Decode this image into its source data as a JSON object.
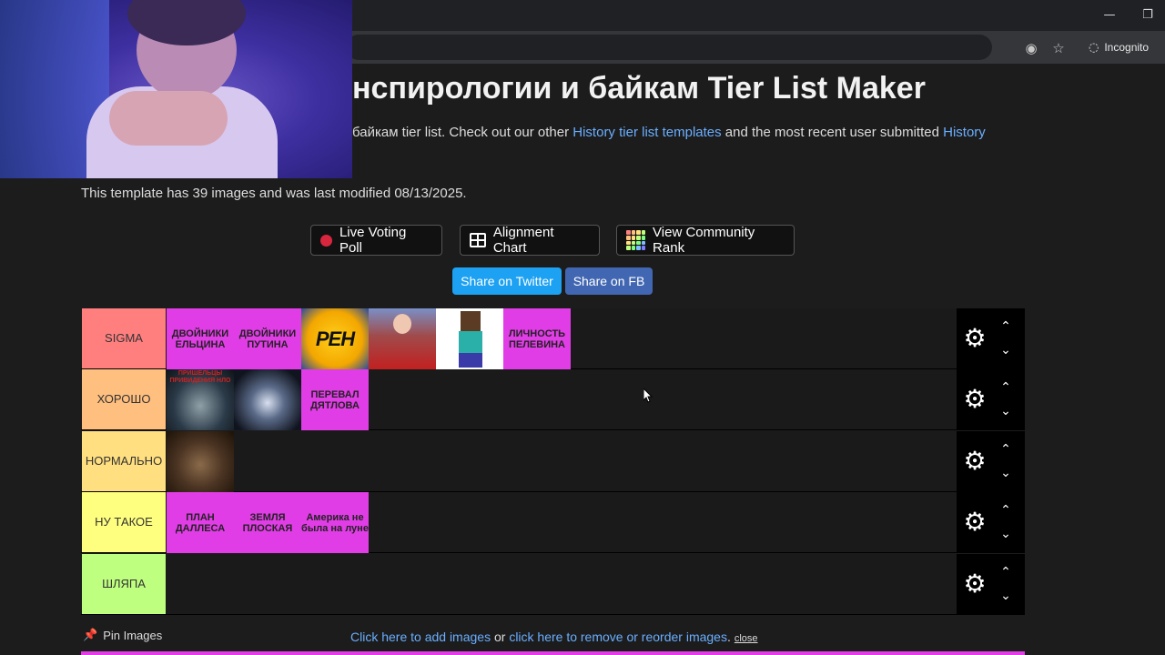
{
  "browser": {
    "incognito_label": "Incognito",
    "minimize_icon": "minimize-icon",
    "restore_icon": "restore-icon",
    "eye_off_icon": "eye-off-icon",
    "star_icon": "star-icon"
  },
  "page": {
    "title": "нспирологии и байкам Tier List Maker",
    "desc_prefix": "байкам tier list. Check out our other ",
    "desc_link1": "History tier list templates",
    "desc_middle": " and the most recent user submitted ",
    "desc_link2": "History",
    "template_info": "This template has 39 images and was last modified 08/13/2025."
  },
  "actions": {
    "live_voting": "Live Voting Poll",
    "alignment_chart": "Alignment Chart",
    "community_rank": "View Community Rank",
    "share_twitter": "Share on Twitter",
    "share_fb": "Share on FB"
  },
  "colors": {
    "twitter": "#1da1f2",
    "fb": "#4267b2",
    "item_pink": "#e13de6",
    "link": "#6aaeff"
  },
  "tiers": [
    {
      "label": "SIGMA",
      "color": "#ff7f7f",
      "items": [
        {
          "type": "text",
          "text": "ДВОЙНИКИ ЕЛЬЦИНА"
        },
        {
          "type": "text",
          "text": "ДВОЙНИКИ ПУТИНА"
        },
        {
          "type": "image",
          "pic": "ren",
          "caption": "РЕН"
        },
        {
          "type": "image",
          "pic": "man"
        },
        {
          "type": "image",
          "pic": "herobrine"
        },
        {
          "type": "text",
          "text": "ЛИЧНОСТЬ ПЕЛЕВИНА"
        }
      ]
    },
    {
      "label": "ХОРОШО",
      "color": "#ffbf7f",
      "items": [
        {
          "type": "image",
          "pic": "dark1",
          "caption": "ПРИШЕЛЬЦЫ ПРИВИДЕНИЯ НЛО"
        },
        {
          "type": "image",
          "pic": "ufo"
        },
        {
          "type": "text",
          "text": "ПЕРЕВАЛ ДЯТЛОВА"
        }
      ]
    },
    {
      "label": "НОРМАЛЬНО",
      "color": "#ffdf7f",
      "items": [
        {
          "type": "image",
          "pic": "wolf"
        }
      ]
    },
    {
      "label": "НУ ТАКОЕ",
      "color": "#ffff7f",
      "items": [
        {
          "type": "text",
          "text": "ПЛАН ДАЛЛЕСА"
        },
        {
          "type": "text",
          "text": "ЗЕМЛЯ ПЛОСКАЯ"
        },
        {
          "type": "text",
          "text": "Америка не была на луне"
        }
      ]
    },
    {
      "label": "ШЛЯПА",
      "color": "#bfff7f",
      "items": []
    }
  ],
  "bottom": {
    "pin_label": "Pin Images",
    "add_link": "Click here to add images",
    "or_text": " or ",
    "remove_link": "click here to remove or reorder images",
    "period": ".",
    "close_label": "close"
  }
}
